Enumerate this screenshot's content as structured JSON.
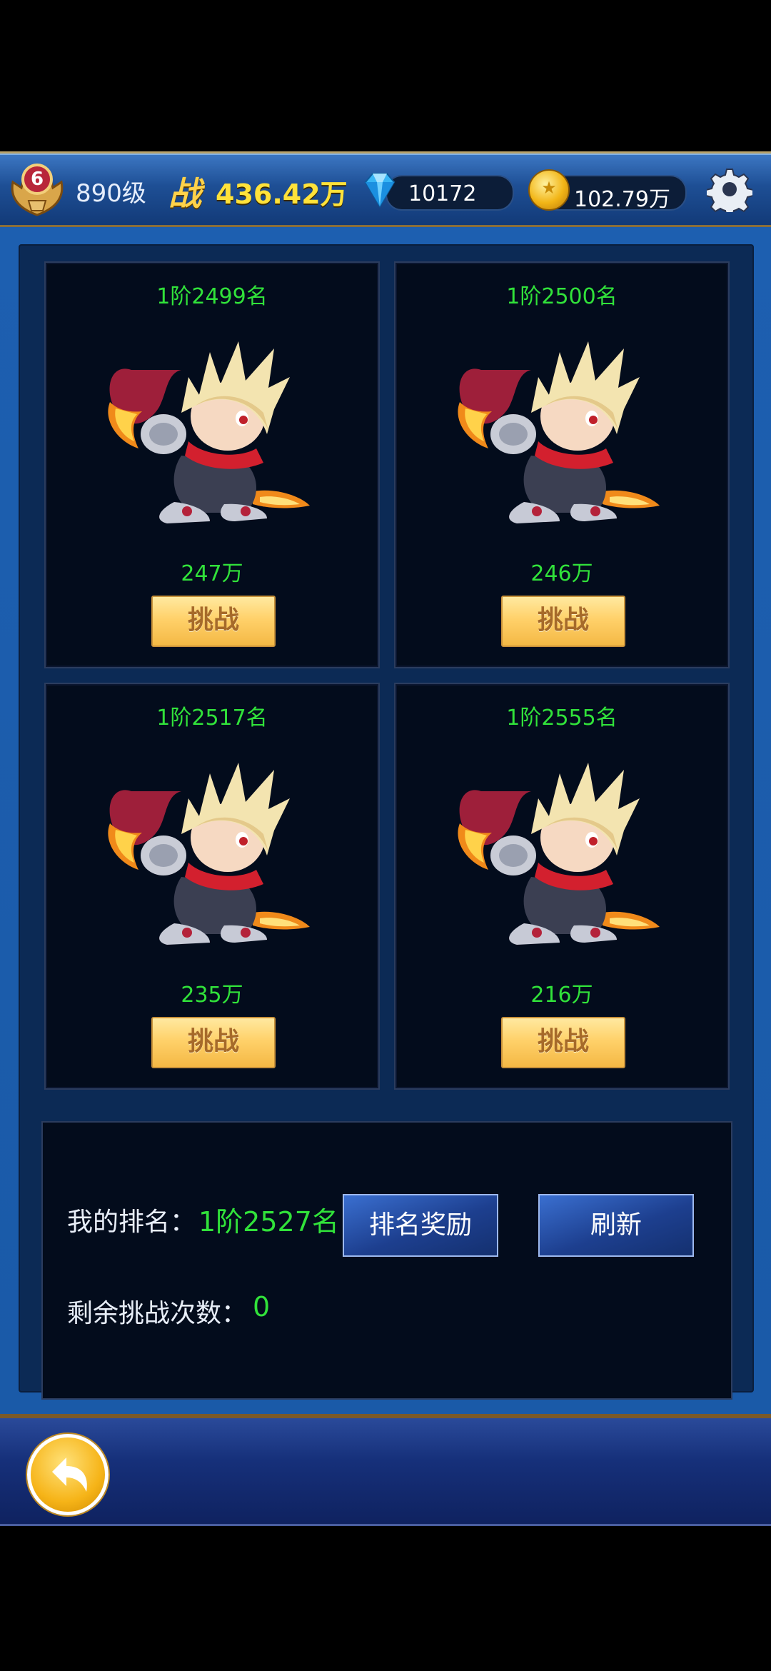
{
  "header": {
    "rank_badge": "6",
    "level": "890级",
    "power_glyph": "战",
    "power": "436.42万",
    "diamonds": "10172",
    "gold": "102.79万",
    "icons": [
      "rank-badge-icon",
      "diamond-icon",
      "gold-coin-icon",
      "gear-icon"
    ]
  },
  "opponents": [
    {
      "rank": "1阶2499名",
      "power": "247万",
      "button": "挑战"
    },
    {
      "rank": "1阶2500名",
      "power": "246万",
      "button": "挑战"
    },
    {
      "rank": "1阶2517名",
      "power": "235万",
      "button": "挑战"
    },
    {
      "rank": "1阶2555名",
      "power": "216万",
      "button": "挑战"
    }
  ],
  "info": {
    "my_rank_label": "我的排名：",
    "my_rank_value": "1阶2527名",
    "reward_button": "排名奖励",
    "refresh_button": "刷新",
    "remaining_label": "剩余挑战次数：",
    "remaining_value": "0"
  },
  "colors": {
    "accent_green": "#31e23a",
    "gold_text": "#ffe23a",
    "button_gold": "#ffd16a"
  },
  "footer": {
    "back_icon": "back-arrow-icon"
  }
}
